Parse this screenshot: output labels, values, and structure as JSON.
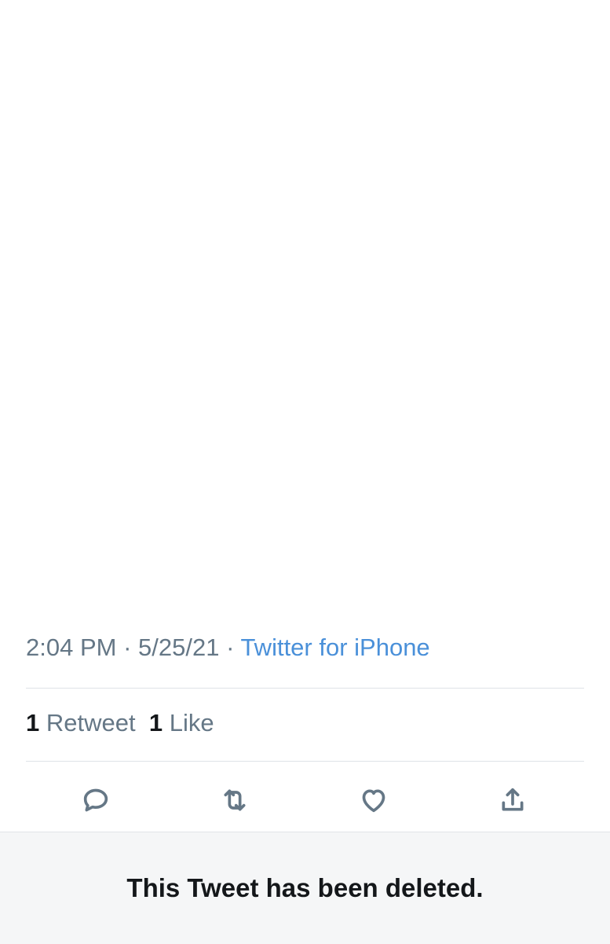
{
  "tweet": {
    "time": "2:04 PM",
    "sep1": " · ",
    "date": "5/25/21",
    "sep2": " · ",
    "source": "Twitter for iPhone",
    "retweet_count": "1",
    "retweet_label": "Retweet",
    "like_count": "1",
    "like_label": "Like"
  },
  "actions": [
    {
      "icon": "reply-icon"
    },
    {
      "icon": "retweet-icon"
    },
    {
      "icon": "like-icon"
    },
    {
      "icon": "share-icon"
    }
  ],
  "notice": {
    "text": "This Tweet has been deleted."
  },
  "colors": {
    "link": "#4a90d9",
    "meta": "#657786",
    "text": "#14171a",
    "notice_bg": "#f5f6f7"
  }
}
